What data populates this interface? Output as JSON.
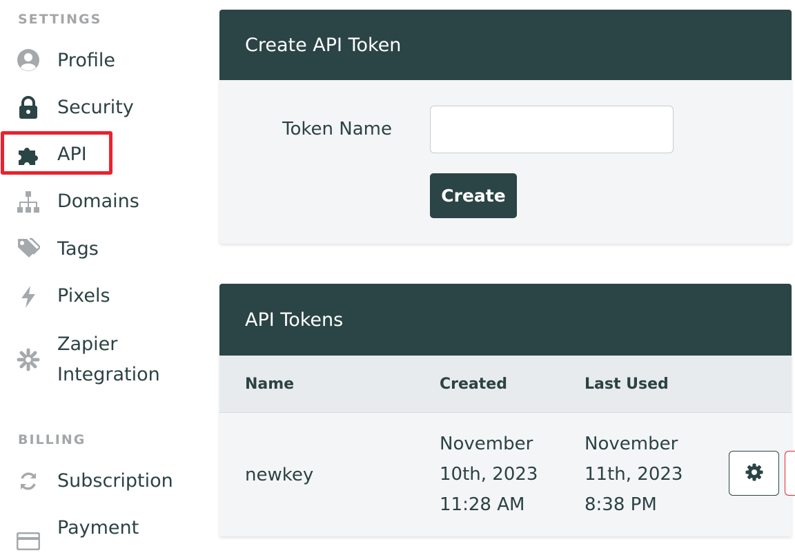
{
  "sidebar": {
    "settings_label": "SETTINGS",
    "billing_label": "BILLING",
    "items": [
      {
        "label": "Profile",
        "icon": "user-circle-icon"
      },
      {
        "label": "Security",
        "icon": "lock-icon"
      },
      {
        "label": "API",
        "icon": "puzzle-icon"
      },
      {
        "label": "Domains",
        "icon": "sitemap-icon"
      },
      {
        "label": "Tags",
        "icon": "tags-icon"
      },
      {
        "label": "Pixels",
        "icon": "bolt-icon"
      },
      {
        "label": "Zapier Integration",
        "icon": "asterisk-icon"
      }
    ],
    "billing_items": [
      {
        "label": "Subscription",
        "icon": "sync-icon"
      },
      {
        "label": "Payment",
        "icon": "credit-card-icon"
      }
    ],
    "highlighted": "API",
    "highlight_color": "#e8222e"
  },
  "create_card": {
    "title": "Create API Token",
    "token_name_label": "Token Name",
    "token_name_value": "",
    "create_button": "Create"
  },
  "tokens_card": {
    "title": "API Tokens",
    "columns": [
      "Name",
      "Created",
      "Last Used"
    ],
    "rows": [
      {
        "name": "newkey",
        "created": [
          "November",
          "10th, 2023",
          "11:28 AM"
        ],
        "last_used": [
          "November",
          "11th, 2023",
          "8:38 PM"
        ]
      }
    ]
  },
  "colors": {
    "header_bg": "#2b4445",
    "card_bg": "#f4f5f7",
    "table_header_bg": "#e7ebee",
    "accent_red": "#e8222e"
  }
}
